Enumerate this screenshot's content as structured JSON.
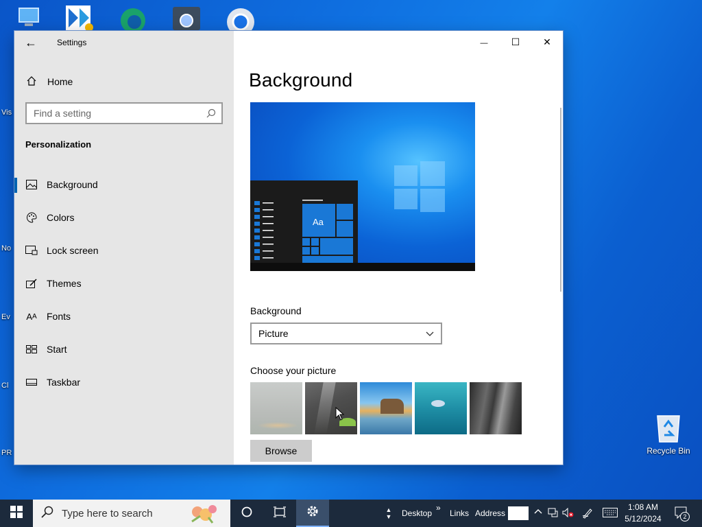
{
  "window": {
    "title": "Settings",
    "back_glyph": "←",
    "minimize_glyph": "—",
    "maximize_glyph": "☐",
    "close_glyph": "✕"
  },
  "sidebar": {
    "home_label": "Home",
    "search_placeholder": "Find a setting",
    "section_title": "Personalization",
    "items": [
      {
        "label": "Background",
        "icon": "picture-icon",
        "active": true
      },
      {
        "label": "Colors",
        "icon": "palette-icon",
        "active": false
      },
      {
        "label": "Lock screen",
        "icon": "lock-screen-icon",
        "active": false
      },
      {
        "label": "Themes",
        "icon": "themes-icon",
        "active": false
      },
      {
        "label": "Fonts",
        "icon": "fonts-icon",
        "active": false
      },
      {
        "label": "Start",
        "icon": "start-icon",
        "active": false
      },
      {
        "label": "Taskbar",
        "icon": "taskbar-icon",
        "active": false
      }
    ]
  },
  "main": {
    "heading": "Background",
    "preview_tile_text": "Aa",
    "background_label": "Background",
    "background_value": "Picture",
    "choose_label": "Choose your picture",
    "browse_label": "Browse"
  },
  "desktop": {
    "recycle_bin_label": "Recycle Bin",
    "left_labels": [
      "Vis",
      "No",
      "Ev",
      "Cl",
      "PR"
    ]
  },
  "taskbar": {
    "search_placeholder": "Type here to search",
    "toolbar_desktop": "Desktop",
    "toolbar_chevron": "»",
    "toolbar_links": "Links",
    "toolbar_address": "Address",
    "time": "1:08 AM",
    "date": "5/12/2024",
    "notification_count": "2"
  },
  "colors": {
    "accent": "#0063b1",
    "sidebar_bg": "#e6e6e6",
    "taskbar_bg": "#1c2a3c"
  }
}
